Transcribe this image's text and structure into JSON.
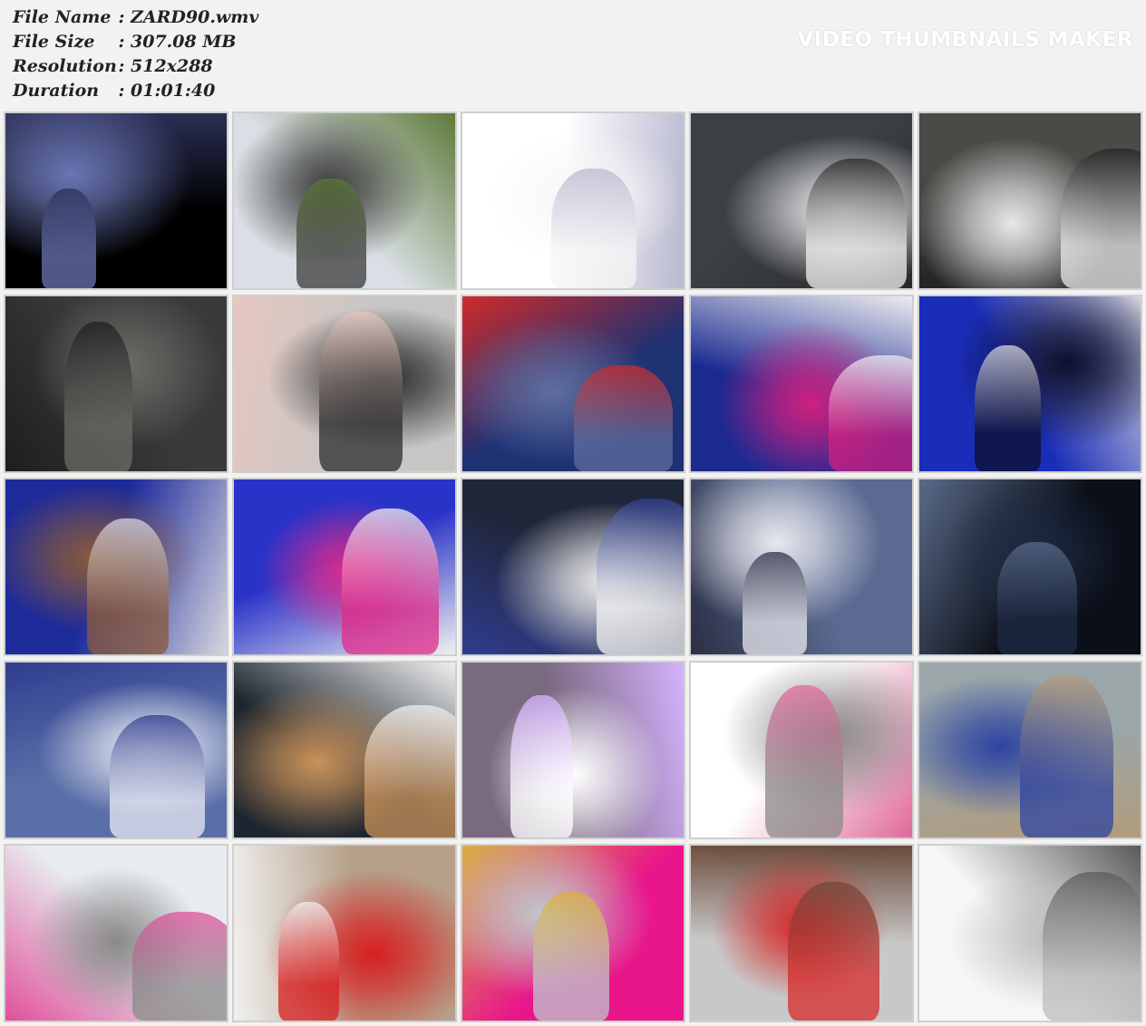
{
  "file_info": {
    "rows": [
      {
        "label": "File Name",
        "sep": ":",
        "value": "ZARD90.wmv"
      },
      {
        "label": "File Size",
        "sep": ":",
        "value": "307.08 MB"
      },
      {
        "label": "Resolution",
        "sep": ":",
        "value": "512x288"
      },
      {
        "label": "Duration",
        "sep": ":",
        "value": "01:01:40"
      }
    ]
  },
  "watermark": {
    "by": "by Scorp",
    "title": "VIDEO THUMBNAILS MAKER"
  },
  "thumbnails": [
    {
      "scene": "woman-blue-light",
      "colors": [
        "#000000",
        "#6a76b5",
        "#2b2f55"
      ]
    },
    {
      "scene": "black-suit-outdoor",
      "colors": [
        "#d9dfe4",
        "#3b3b3b",
        "#5e7a3a"
      ]
    },
    {
      "scene": "white-credits",
      "colors": [
        "#ffffff",
        "#f6f6f6",
        "#b8b8d0"
      ]
    },
    {
      "scene": "white-suit-bound",
      "colors": [
        "#3c4044",
        "#f0f0f2",
        "#2a2a2a"
      ]
    },
    {
      "scene": "white-suit-bound-2",
      "colors": [
        "#4a4a46",
        "#e8e8ea",
        "#232323"
      ]
    },
    {
      "scene": "control-panel",
      "colors": [
        "#3a3a3a",
        "#6a6a66",
        "#1e1e1e"
      ]
    },
    {
      "scene": "villainess-doorway",
      "colors": [
        "#c8c6c4",
        "#2c2c2c",
        "#e7c7c0"
      ]
    },
    {
      "scene": "blue-room-fight",
      "colors": [
        "#1d3173",
        "#5e6d9e",
        "#cf2a2a"
      ]
    },
    {
      "scene": "pink-ranger",
      "colors": [
        "#1a2a8f",
        "#d02080",
        "#ececf0"
      ]
    },
    {
      "scene": "villainess-blue",
      "colors": [
        "#1a2db8",
        "#0d0f2c",
        "#d9d9e0"
      ]
    },
    {
      "scene": "villainess-closeup",
      "colors": [
        "#1d2a9a",
        "#8a5a3a",
        "#d7d7df"
      ]
    },
    {
      "scene": "pink-ranger-hair",
      "colors": [
        "#2a33c8",
        "#e02a8a",
        "#f0f0f0"
      ]
    },
    {
      "scene": "scientist-and-ranger",
      "colors": [
        "#20263a",
        "#f0f0f0",
        "#2f3d8f"
      ]
    },
    {
      "scene": "fog-battle",
      "colors": [
        "#5a6a90",
        "#e8e8ee",
        "#2b2f45"
      ]
    },
    {
      "scene": "dark-room",
      "colors": [
        "#0b0f18",
        "#1e2a44",
        "#5a6a88"
      ]
    },
    {
      "scene": "two-bound-rangers",
      "colors": [
        "#5a6fa8",
        "#e8eaf2",
        "#2f3d8f"
      ]
    },
    {
      "scene": "eyepatch-villain",
      "colors": [
        "#1d2630",
        "#c9925a",
        "#f0f0f0"
      ]
    },
    {
      "scene": "chain-flash",
      "colors": [
        "#7a6a80",
        "#ffffff",
        "#d6b2ff"
      ]
    },
    {
      "scene": "white-impact",
      "colors": [
        "#ffffff",
        "#8a8a8a",
        "#e06a9a"
      ]
    },
    {
      "scene": "beach-rangers",
      "colors": [
        "#9aa6a8",
        "#2e44a0",
        "#b29c7c"
      ]
    },
    {
      "scene": "cat-monster-beach",
      "colors": [
        "#e8ecf0",
        "#8a8a8a",
        "#e0509a"
      ]
    },
    {
      "scene": "red-ranger-beach",
      "colors": [
        "#b6a089",
        "#d62020",
        "#f0f0f0"
      ]
    },
    {
      "scene": "pink-closeup-emblem",
      "colors": [
        "#e8168a",
        "#c0c6cc",
        "#d9b040"
      ]
    },
    {
      "scene": "woman-red-uniform",
      "colors": [
        "#c8c8c8",
        "#d62a2a",
        "#6a4a3a"
      ]
    },
    {
      "scene": "end-credits",
      "colors": [
        "#f6f6f6",
        "#bdbdbd",
        "#5a5a5a"
      ]
    }
  ]
}
